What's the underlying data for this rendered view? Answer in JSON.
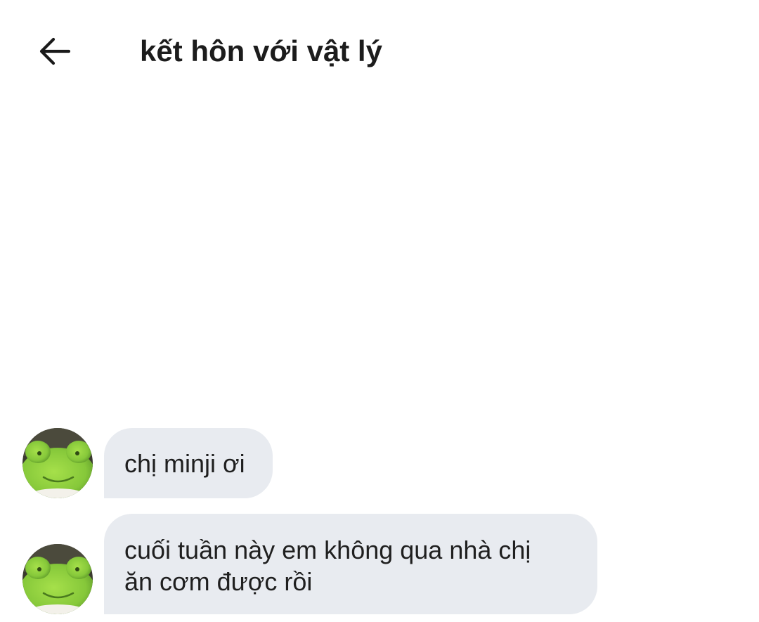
{
  "header": {
    "title": "kết hôn với vật lý",
    "back_icon": "arrow-left-icon"
  },
  "messages": [
    {
      "text": "chị minji ơi",
      "avatar_icon": "green-frog-plush-avatar"
    },
    {
      "text": "cuối tuần này em không qua nhà chị ăn cơm được rồi",
      "avatar_icon": "green-frog-plush-avatar"
    }
  ],
  "colors": {
    "background": "#ffffff",
    "bubble": "#e8ebf0",
    "text": "#1c1c1c",
    "avatar_green": "#8fd13a"
  }
}
